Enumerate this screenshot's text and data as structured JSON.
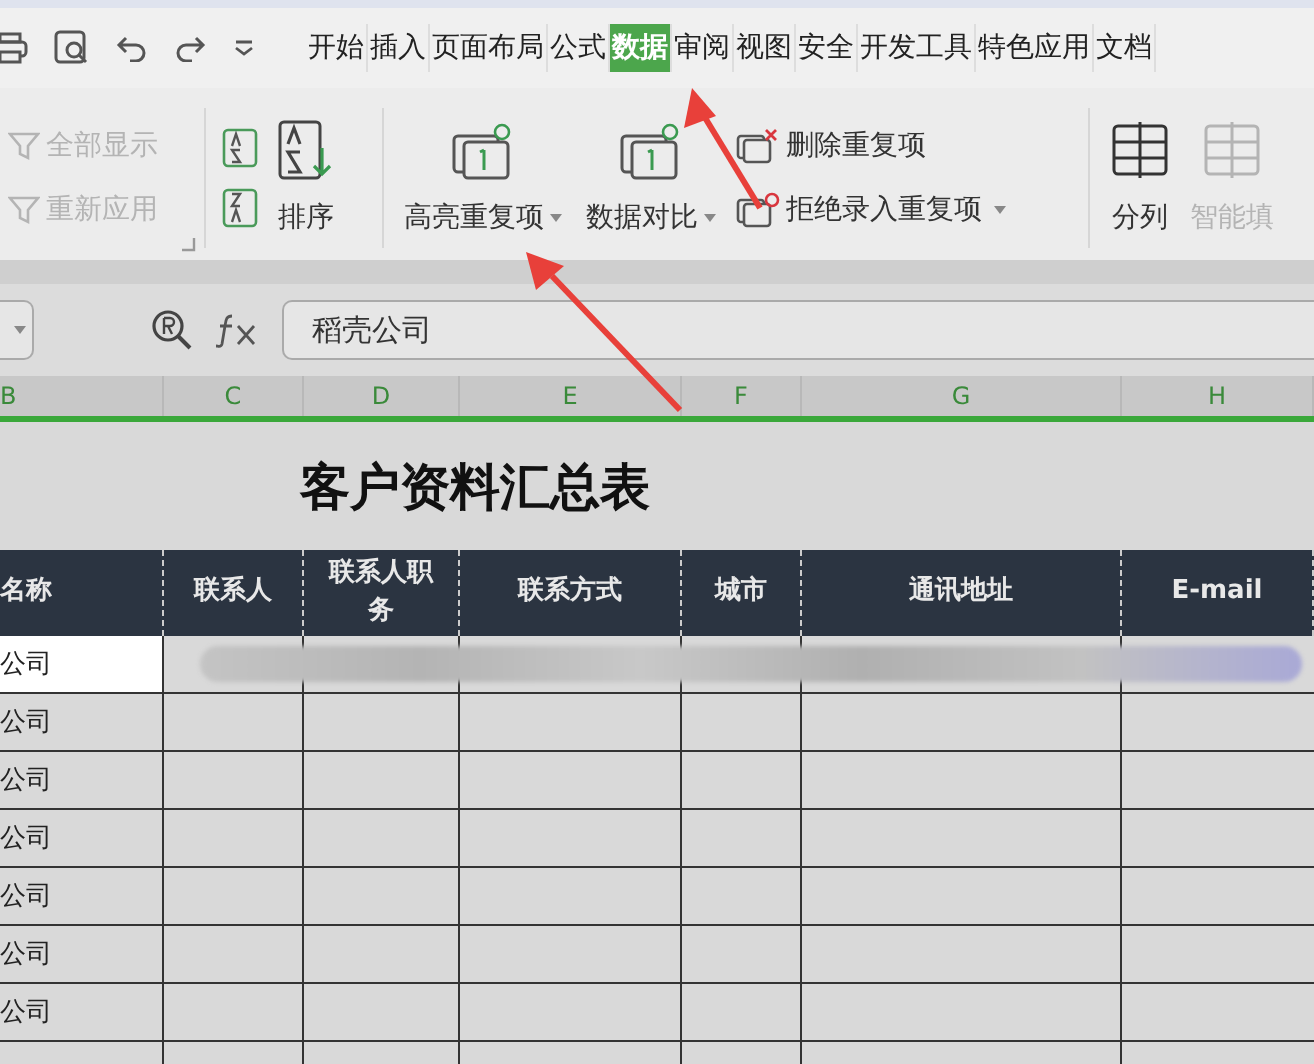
{
  "tabs": [
    {
      "label": "开始",
      "selected": false
    },
    {
      "label": "插入",
      "selected": false
    },
    {
      "label": "页面布局",
      "selected": false
    },
    {
      "label": "公式",
      "selected": false
    },
    {
      "label": "数据",
      "selected": true
    },
    {
      "label": "审阅",
      "selected": false
    },
    {
      "label": "视图",
      "selected": false
    },
    {
      "label": "安全",
      "selected": false
    },
    {
      "label": "开发工具",
      "selected": false
    },
    {
      "label": "特色应用",
      "selected": false
    },
    {
      "label": "文档",
      "selected": false
    }
  ],
  "ribbon": {
    "filter": [
      {
        "label": "全部显示",
        "disabled": true
      },
      {
        "label": "重新应用",
        "disabled": true
      }
    ],
    "sort": {
      "label": "排序"
    },
    "duplicates_large": [
      {
        "label": "高亮重复项",
        "dropdown": true
      },
      {
        "label": "数据对比",
        "dropdown": true
      }
    ],
    "duplicates_small": [
      {
        "label": "删除重复项",
        "dropdown": false,
        "kind": "delete"
      },
      {
        "label": "拒绝录入重复项",
        "dropdown": true,
        "kind": "reject"
      }
    ],
    "tools": [
      {
        "label": "分列",
        "disabled": false
      },
      {
        "label": "智能填",
        "disabled": true
      }
    ]
  },
  "formula_bar": {
    "value": "稻壳公司"
  },
  "columns": [
    "B",
    "C",
    "D",
    "E",
    "F",
    "G",
    "H"
  ],
  "sheet": {
    "title": "客户资料汇总表",
    "headers": [
      "名称",
      "联系人",
      "联系人职务",
      "联系方式",
      "城市",
      "通讯地址",
      "E-mail"
    ],
    "rows": [
      {
        "company": "公司",
        "selected": true,
        "redacted": true
      },
      {
        "company": "公司",
        "selected": false,
        "redacted": false
      },
      {
        "company": "公司",
        "selected": false,
        "redacted": false
      },
      {
        "company": "公司",
        "selected": false,
        "redacted": false
      },
      {
        "company": "公司",
        "selected": false,
        "redacted": false
      },
      {
        "company": "公司",
        "selected": false,
        "redacted": false
      },
      {
        "company": "公司",
        "selected": false,
        "redacted": false
      }
    ]
  }
}
